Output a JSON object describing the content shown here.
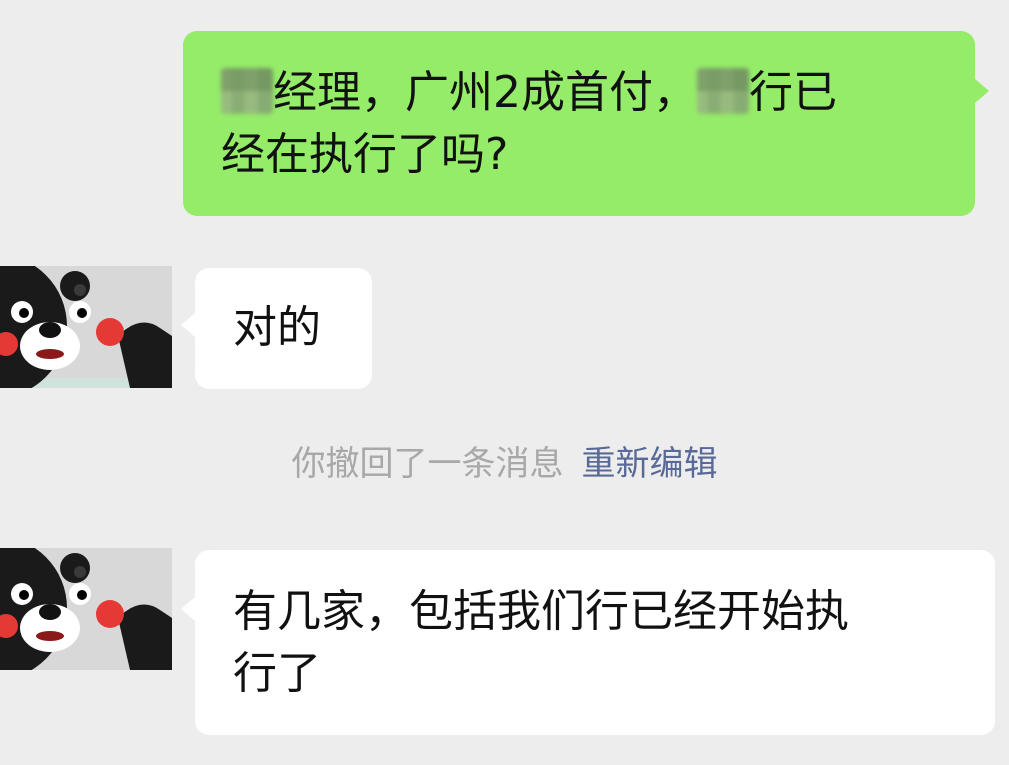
{
  "chat": {
    "messages": [
      {
        "direction": "outgoing",
        "line1_part1": "经理，广州2成首付，",
        "line1_part2": "行已",
        "line2": "经在执行了吗?"
      },
      {
        "direction": "incoming",
        "text": "对的"
      },
      {
        "direction": "incoming",
        "line1": "有几家，包括我们行已经开始执",
        "line2": "行了"
      }
    ],
    "recall_notice": {
      "text": "你撤回了一条消息",
      "link": "重新编辑"
    }
  },
  "colors": {
    "background": "#ededed",
    "outgoing_bubble": "#95ec69",
    "incoming_bubble": "#ffffff",
    "recall_text": "#a8a8a8",
    "recall_link": "#5a6a98"
  }
}
